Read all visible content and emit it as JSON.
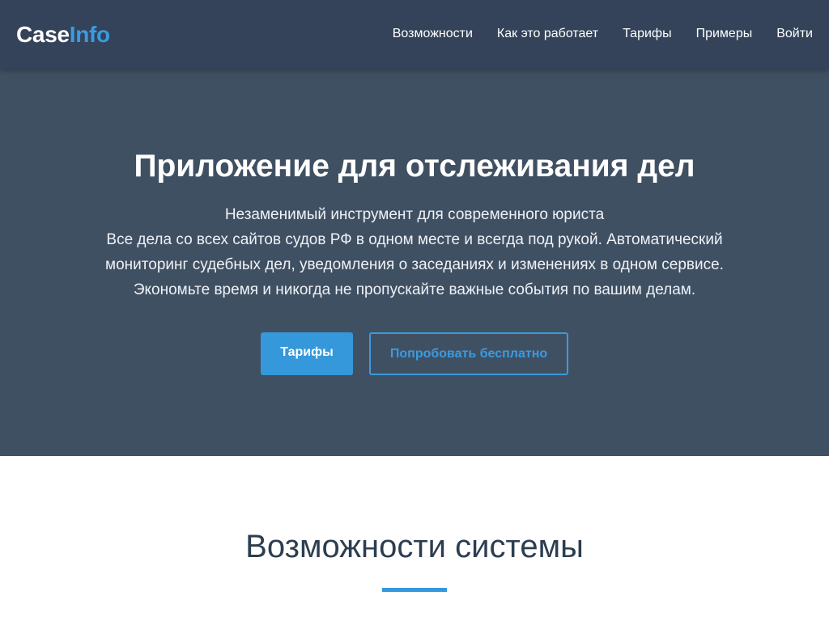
{
  "brand": {
    "part1": "Case",
    "part2": "Info"
  },
  "nav": {
    "items": [
      {
        "label": "Возможности"
      },
      {
        "label": "Как это работает"
      },
      {
        "label": "Тарифы"
      },
      {
        "label": "Примеры"
      },
      {
        "label": "Войти"
      }
    ]
  },
  "hero": {
    "title": "Приложение для отслеживания дел",
    "lines": [
      "Незаменимый инструмент для современного юриста",
      "Все дела со всех сайтов судов РФ в одном месте и всегда под рукой. Автоматический мониторинг судебных дел, уведомления о заседаниях и изменениях в одном сервисе.",
      "Экономьте время и никогда не пропускайте важные события по вашим делам."
    ],
    "primary_button": "Тарифы",
    "secondary_button": "Попробовать бесплатно"
  },
  "features": {
    "title": "Возможности системы"
  },
  "colors": {
    "navbar": "#344359",
    "hero_bg": "#405063",
    "accent": "#3498db",
    "text_dark": "#2c3e50"
  }
}
